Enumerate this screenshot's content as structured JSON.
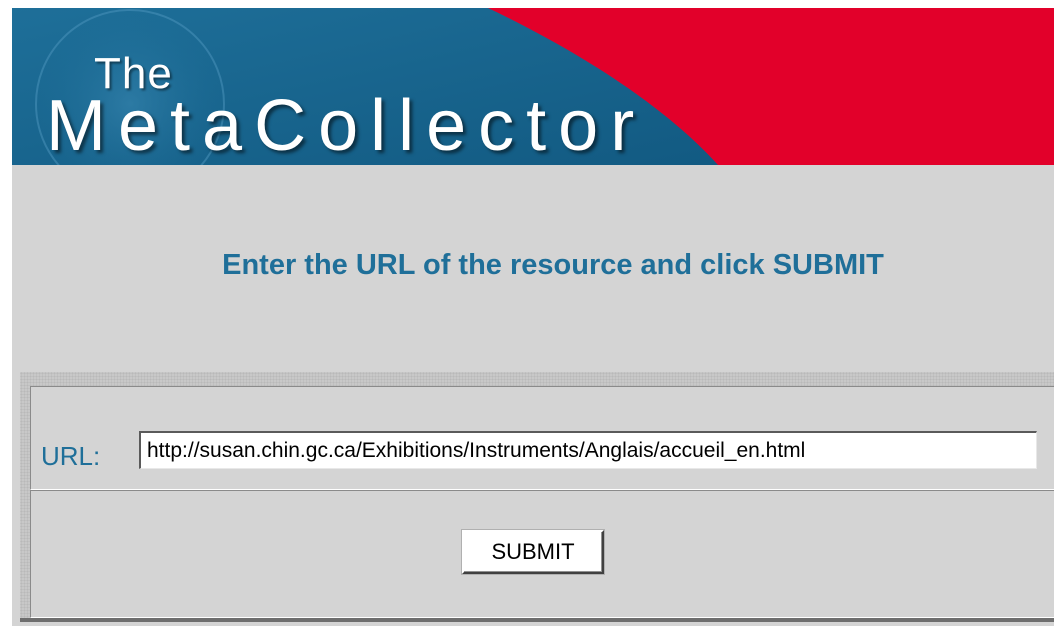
{
  "banner": {
    "title_small": "The",
    "title_large": "MetaCollector",
    "colors": {
      "blue": "#1a6a95",
      "red": "#e2002a"
    }
  },
  "instruction": "Enter the URL of the resource and click SUBMIT",
  "form": {
    "url_label": "URL:",
    "url_value": "http://susan.chin.gc.ca/Exhibitions/Instruments/Anglais/accueil_en.html",
    "submit_label": "SUBMIT"
  },
  "colors": {
    "accent_text": "#1f6f99",
    "panel_bg": "#d4d4d4"
  }
}
